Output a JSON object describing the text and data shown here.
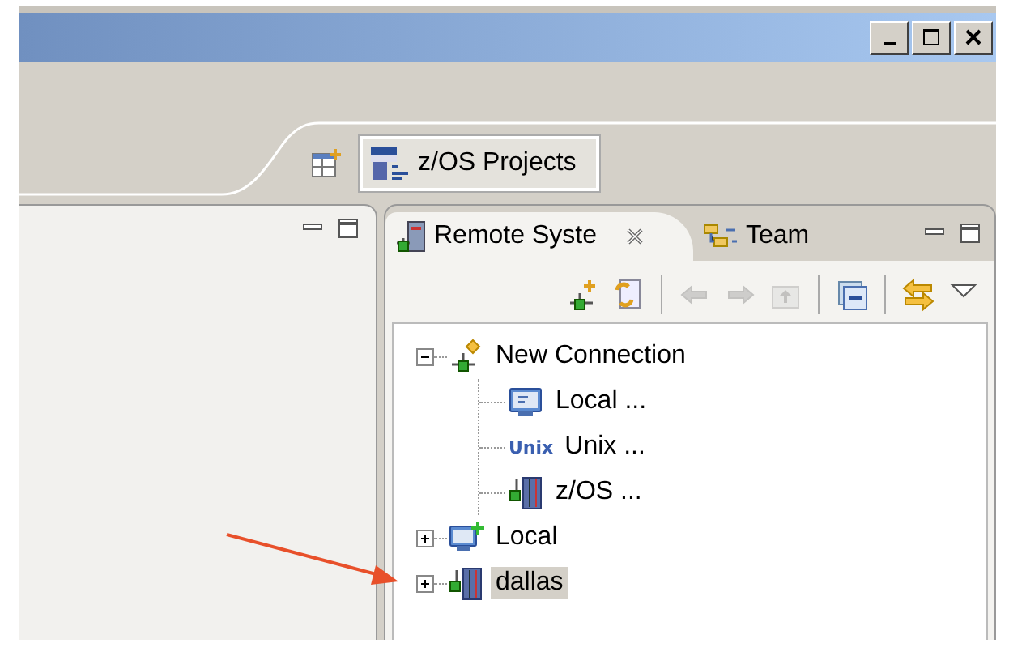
{
  "perspective_bar": {
    "button": {
      "label": "z/OS Projects",
      "selected": true
    }
  },
  "right_view": {
    "tabs": [
      {
        "label": "Remote Syste",
        "selected": true,
        "closable": true,
        "kind": "remote"
      },
      {
        "label": "Team",
        "selected": false,
        "closable": false,
        "kind": "team"
      }
    ],
    "toolbar": [
      {
        "kind": "new-connection",
        "disabled": false
      },
      {
        "kind": "refresh",
        "disabled": false
      },
      {
        "kind": "back",
        "disabled": true
      },
      {
        "kind": "forward",
        "disabled": true
      },
      {
        "kind": "up",
        "disabled": true
      },
      {
        "kind": "collapse",
        "disabled": false
      },
      {
        "kind": "link",
        "disabled": false
      },
      {
        "kind": "menu",
        "disabled": false
      }
    ],
    "tree": [
      {
        "label": "New Connection",
        "kind": "connection",
        "expanded": true,
        "selected": false,
        "children": [
          {
            "label": "Local ...",
            "kind": "local",
            "selected": false
          },
          {
            "label": "Unix ...",
            "kind": "unix",
            "icon_text": "Unix",
            "selected": false
          },
          {
            "label": "z/OS ...",
            "kind": "zos",
            "selected": false
          }
        ]
      },
      {
        "label": "Local",
        "kind": "local-new",
        "expanded": false,
        "selected": false
      },
      {
        "label": "dallas",
        "kind": "zos",
        "expanded": false,
        "selected": true
      }
    ]
  }
}
